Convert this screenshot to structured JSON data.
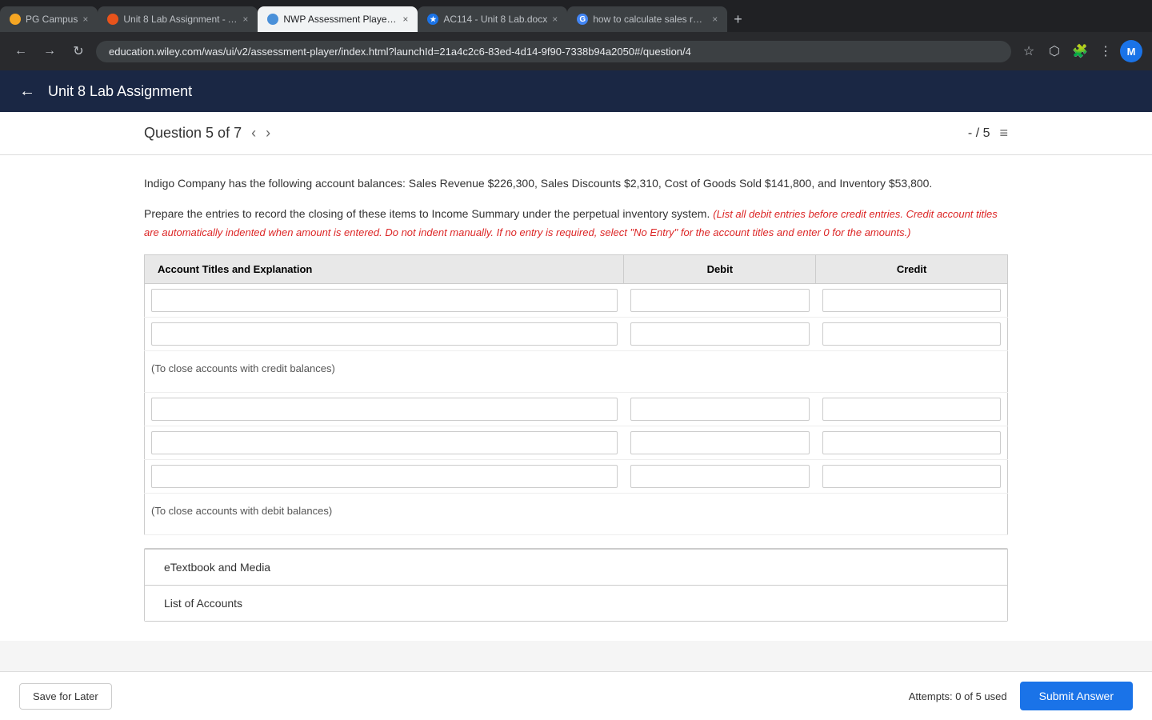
{
  "browser": {
    "tabs": [
      {
        "id": "tab1",
        "label": "PG Campus",
        "favicon_color": "#f5a623",
        "active": false,
        "closeable": true
      },
      {
        "id": "tab2",
        "label": "Unit 8 Lab Assignment - AC114",
        "favicon_color": "#e8531b",
        "active": false,
        "closeable": true
      },
      {
        "id": "tab3",
        "label": "NWP Assessment Player UI Ap...",
        "favicon_color": "#4a90d9",
        "active": true,
        "closeable": true
      },
      {
        "id": "tab4",
        "label": "AC114 - Unit 8 Lab.docx",
        "favicon_color": "#1a73e8",
        "active": false,
        "closeable": true
      },
      {
        "id": "tab5",
        "label": "how to calculate sales revenue",
        "favicon_color": "#4285f4",
        "active": false,
        "closeable": true
      }
    ],
    "address": "education.wiley.com/was/ui/v2/assessment-player/index.html?launchId=21a4c2c6-83ed-4d14-9f90-7338b94a2050#/question/4",
    "profile_initial": "M"
  },
  "app": {
    "back_label": "←",
    "title": "Unit 8 Lab Assignment"
  },
  "question": {
    "label": "Question 5 of 7",
    "score": "- / 5",
    "prev_arrow": "‹",
    "next_arrow": "›"
  },
  "content": {
    "question_text": "Indigo Company has the following account balances: Sales Revenue $226,300, Sales Discounts $2,310, Cost of Goods Sold $141,800, and Inventory $53,800.",
    "instructions_text": "Prepare the entries to record the closing of these items to Income Summary under the perpetual inventory system.",
    "instructions_highlight": "(List all debit entries before credit entries. Credit account titles are automatically indented when amount is entered. Do not indent manually. If no entry is required, select \"No Entry\" for the account titles and enter 0 for the amounts.)",
    "table": {
      "headers": [
        "Account Titles and Explanation",
        "Debit",
        "Credit"
      ],
      "section1_note": "(To close accounts with credit balances)",
      "section2_note": "(To close accounts with debit balances)"
    },
    "etextbook_label": "eTextbook and Media",
    "list_of_accounts_label": "List of Accounts"
  },
  "footer": {
    "save_later_label": "Save for Later",
    "attempts_text": "Attempts: 0 of 5 used",
    "submit_label": "Submit Answer"
  }
}
